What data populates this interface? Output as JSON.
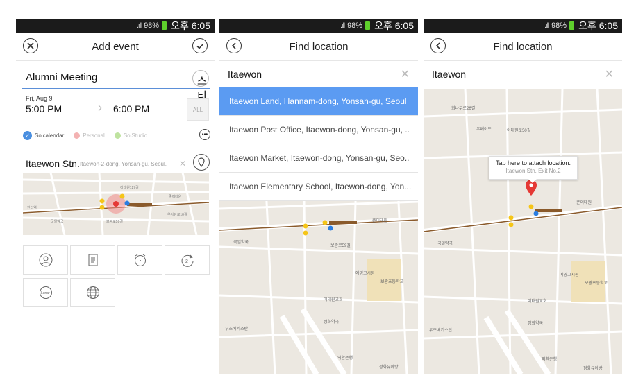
{
  "status": {
    "signal": ".ıll",
    "battery": "98%",
    "time": "오후 6:05"
  },
  "screen1": {
    "title": "Add event",
    "event_title": "Alumni Meeting",
    "sticker": "스티커",
    "date": "Fri, Aug 9",
    "start_time": "5:00 PM",
    "end_time": "6:00 PM",
    "all_day": "ALL",
    "calendars": [
      {
        "label": "Solcalendar",
        "color": "#4a8fe0"
      },
      {
        "label": "Personal",
        "color": "#f3b2b2"
      },
      {
        "label": "SolStudio",
        "color": "#bfe3a0"
      }
    ],
    "location_name": "Itaewon Stn.",
    "location_address": "Itaewon-2-dong, Yonsan-gu, Seoul."
  },
  "screen2": {
    "title": "Find location",
    "search_value": "Itaewon",
    "results": [
      "Itaewon Land, Hannam-dong, Yonsan-gu, Seoul",
      "Itaewon Post Office, Itaewon-dong, Yonsan-gu, ..",
      "Itaewon Market, Itaewon-dong, Yonsan-gu, Seo..",
      "Itaewon Elementary School, Itaewon-dong, Yon..."
    ]
  },
  "screen3": {
    "title": "Find location",
    "search_value": "Itaewon",
    "tooltip_title": "Tap here to attach location.",
    "tooltip_sub": "Itaewon Stn. Exit No.2"
  },
  "colors": {
    "accent": "#5b9bf2",
    "pin": "#e53935",
    "rail": "#8a5a2b"
  }
}
